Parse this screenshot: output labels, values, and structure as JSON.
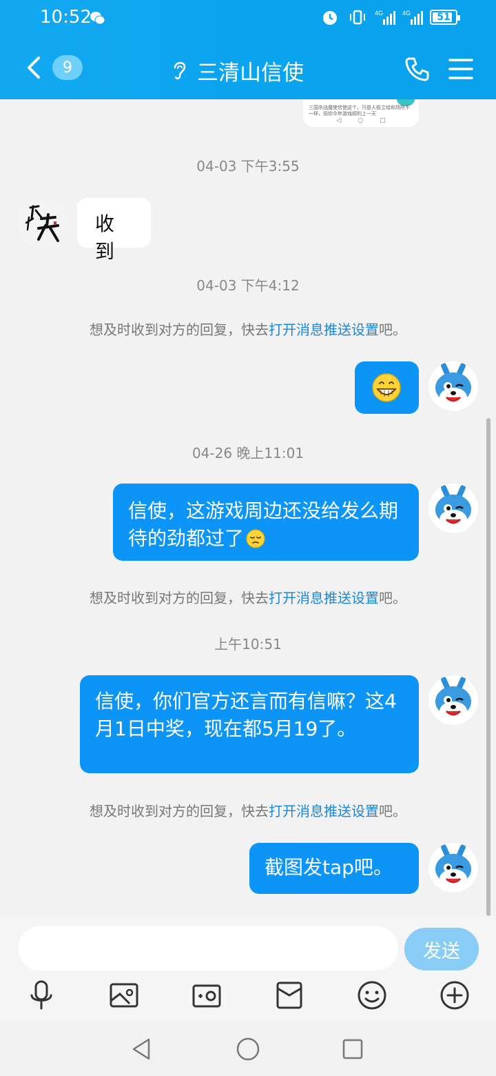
{
  "status_bar": {
    "time": "10:52",
    "battery": "51",
    "net_1": "4G",
    "net_2": "4G"
  },
  "header": {
    "unread_count": "9",
    "title": "三清山信使"
  },
  "thumbnail": {
    "text": "三国杀战魔使信使这个。只是人极立给和场所不一样，祝你今年游戏顺利上一天"
  },
  "messages": [
    {
      "type": "timestamp",
      "text": "04-03 下午3:55"
    },
    {
      "type": "incoming",
      "text": "收到"
    },
    {
      "type": "timestamp",
      "text": "04-03 下午4:12"
    },
    {
      "type": "notice",
      "prefix": "想及时收到对方的回复，快去",
      "link": "打开消息推送设置",
      "suffix": "吧。"
    },
    {
      "type": "outgoing",
      "emoji": "grinning-face"
    },
    {
      "type": "timestamp",
      "text": "04-26 晚上11:01"
    },
    {
      "type": "outgoing",
      "text": "信使，这游戏周边还没给发么期待的劲都过了"
    },
    {
      "type": "notice",
      "prefix": "想及时收到对方的回复，快去",
      "link": "打开消息推送设置",
      "suffix": "吧。"
    },
    {
      "type": "timestamp",
      "text": "上午10:51"
    },
    {
      "type": "outgoing",
      "text": "信使，你们官方还言而有信嘛？这4月1日中奖，现在都5月19了。"
    },
    {
      "type": "notice",
      "prefix": "想及时收到对方的回复，快去",
      "link": "打开消息推送设置",
      "suffix": "吧。"
    },
    {
      "type": "outgoing",
      "text": "截图发tap吧。"
    }
  ],
  "input": {
    "placeholder": "",
    "send_label": "发送"
  },
  "toolbar": {
    "icons": [
      "microphone-icon",
      "image-icon",
      "camera-icon",
      "red-packet-icon",
      "emoji-icon",
      "plus-icon"
    ]
  },
  "colors": {
    "header": "#0ba4ee",
    "bubble_out": "#0c94f7",
    "link": "#1d86d6",
    "send_button": "#89cdf7"
  }
}
